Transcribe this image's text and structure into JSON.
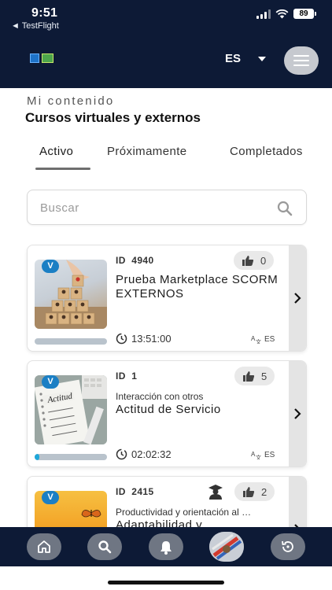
{
  "status_bar": {
    "time": "9:51",
    "back_app": "◄ TestFlight",
    "battery": "89"
  },
  "header": {
    "language": "ES",
    "menu_icon": "hamburger-icon",
    "logo_icon": "app-logo"
  },
  "page": {
    "subtitle": "Mi contenido",
    "title": "Cursos virtuales y externos"
  },
  "tabs": [
    {
      "label": "Activo",
      "active": true
    },
    {
      "label": "Próximamente",
      "active": false
    },
    {
      "label": "Completados",
      "active": false
    }
  ],
  "search": {
    "placeholder": "Buscar",
    "value": ""
  },
  "courses": [
    {
      "badge": "V",
      "id_label": "ID",
      "id": "4940",
      "likes": "0",
      "category": "",
      "title": " Prueba Marketplace SCORM EXTERNOS",
      "duration": "13:51:00",
      "language": "ES",
      "progress": 0,
      "has_mentor": false
    },
    {
      "badge": "V",
      "id_label": "ID",
      "id": "1",
      "likes": "5",
      "category": "Interacción con otros",
      "title": "Actitud de Servicio",
      "duration": "02:02:32",
      "language": "ES",
      "progress": 0.06,
      "has_mentor": false
    },
    {
      "badge": "V",
      "id_label": "ID",
      "id": "2415",
      "likes": "2",
      "category": "Productividad y orientación al …",
      "title": "Adaptabilidad y",
      "duration": "",
      "language": "",
      "progress": 0,
      "has_mentor": true
    }
  ],
  "bottom_nav": [
    {
      "name": "home",
      "icon": "home-icon"
    },
    {
      "name": "search",
      "icon": "search-icon"
    },
    {
      "name": "notifications",
      "icon": "bell-icon"
    },
    {
      "name": "profile",
      "icon": "avatar"
    },
    {
      "name": "history",
      "icon": "history-icon"
    }
  ],
  "colors": {
    "header_bg": "#0d1a36",
    "badge_blue": "#1b7fc4",
    "progress_fill": "#1fa7d9",
    "card_arrow_bg": "#e4e4e4"
  }
}
